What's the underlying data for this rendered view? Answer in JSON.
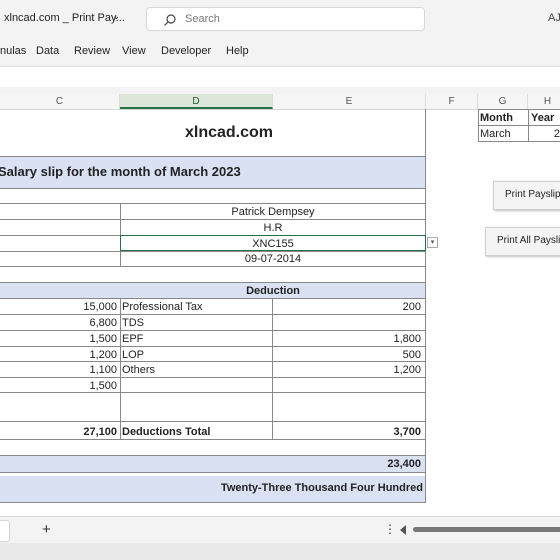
{
  "window": {
    "doc_title": "xlncad.com _ Print Pay...",
    "user_initials": "AJ"
  },
  "search": {
    "placeholder": "Search"
  },
  "menu": [
    "nulas",
    "Data",
    "Review",
    "View",
    "Developer",
    "Help"
  ],
  "columns": [
    "C",
    "D",
    "E",
    "F",
    "G",
    "H"
  ],
  "sheet": {
    "company": "xlncad.com",
    "slip_title": "Salary slip for the month of March 2023",
    "employee": {
      "name": "Patrick Dempsey",
      "department": "H.R",
      "id": "XNC155",
      "date": "09-07-2014"
    },
    "deduction_header": "Deduction",
    "earnings": [
      "15,000",
      "6,800",
      "1,500",
      "1,200",
      "1,100",
      "1,500"
    ],
    "deductions": [
      {
        "label": "Professional Tax",
        "amount": "200"
      },
      {
        "label": "TDS",
        "amount": ""
      },
      {
        "label": "EPF",
        "amount": "1,800"
      },
      {
        "label": "LOP",
        "amount": "500"
      },
      {
        "label": "Others",
        "amount": "1,200"
      }
    ],
    "earnings_total": "27,100",
    "deductions_total_label": "Deductions Total",
    "deductions_total": "3,700",
    "net_pay": "23,400",
    "net_pay_words": "Twenty-Three Thousand Four Hundred"
  },
  "lookup": {
    "month_header": "Month",
    "year_header": "Year",
    "month_value": "March",
    "year_value": "2"
  },
  "buttons": {
    "print_payslip": "Print Payslip",
    "print_all": "Print All Payslips"
  },
  "colors": {
    "band": "#d9e1f2",
    "accent_green": "#217346"
  }
}
